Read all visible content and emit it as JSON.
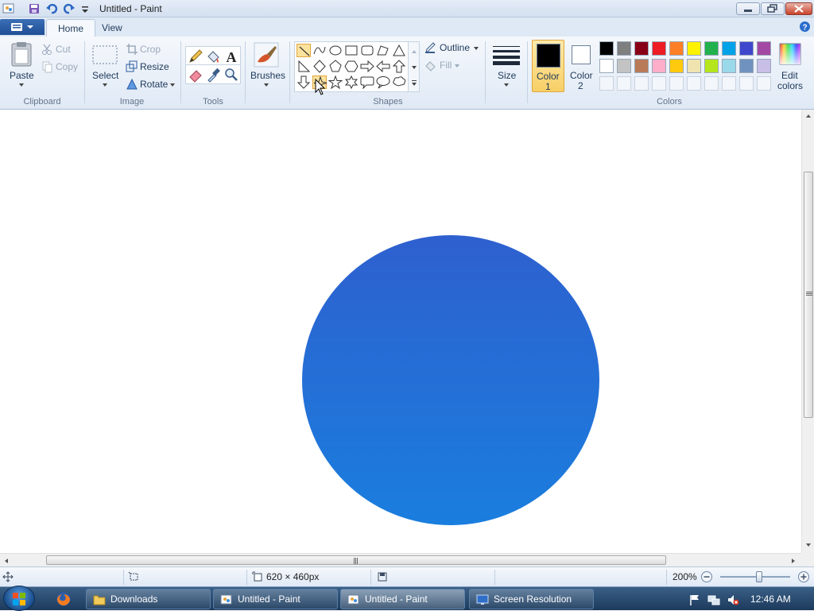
{
  "window": {
    "title": "Untitled - Paint"
  },
  "tabs": [
    {
      "label": "Home"
    },
    {
      "label": "View"
    }
  ],
  "ribbon": {
    "clipboard": {
      "group": "Clipboard",
      "paste": "Paste",
      "cut": "Cut",
      "copy": "Copy"
    },
    "image": {
      "group": "Image",
      "select": "Select",
      "crop": "Crop",
      "resize": "Resize",
      "rotate": "Rotate"
    },
    "tools": {
      "group": "Tools"
    },
    "brushes": {
      "label": "Brushes"
    },
    "shapes": {
      "group": "Shapes",
      "outline": "Outline",
      "fill": "Fill"
    },
    "size": {
      "label": "Size"
    },
    "colors": {
      "group": "Colors",
      "color1_label": "Color",
      "color1_num": "1",
      "color2_label": "Color",
      "color2_num": "2",
      "edit_label": "Edit",
      "edit_label2": "colors",
      "color1": "#000000",
      "color2": "#ffffff",
      "palette_row1": [
        "#000000",
        "#7f7f7f",
        "#880015",
        "#ed1c24",
        "#ff7f27",
        "#fff200",
        "#22b14c",
        "#00a2e8",
        "#3f48cc",
        "#a349a4"
      ],
      "palette_row2": [
        "#ffffff",
        "#c3c3c3",
        "#b97a57",
        "#ffaec9",
        "#ffc90e",
        "#efe4b0",
        "#b5e61d",
        "#99d9ea",
        "#7092be",
        "#c8bfe7"
      ]
    }
  },
  "canvas": {
    "shape_color_top": "#2e60cf",
    "shape_color_bottom": "#1a7ede"
  },
  "statusbar": {
    "dimensions": "620 × 460px",
    "zoom": "200%"
  },
  "taskbar": {
    "items": [
      {
        "label": "Downloads"
      },
      {
        "label": "Untitled - Paint"
      },
      {
        "label": "Untitled - Paint"
      },
      {
        "label": "Screen Resolution"
      }
    ],
    "clock": "12:46 AM"
  }
}
